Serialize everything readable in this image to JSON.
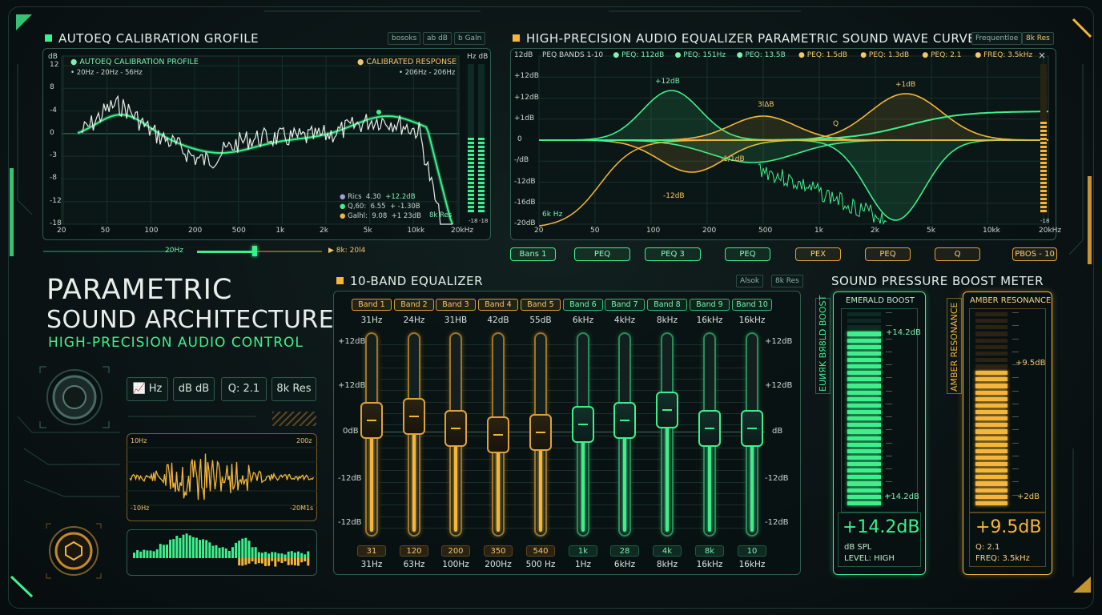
{
  "colors": {
    "emerald": "#3ef08c",
    "amber": "#f5b63a",
    "panel_border": "#2f5c4c",
    "bg": "#0b1416"
  },
  "autoeq": {
    "title": "AUTOEQ CALIBRATION GROFILE",
    "chips": [
      "bosoks",
      "ab dB",
      "b Galn"
    ],
    "legend_left_title": "AUTOEQ CALIBRATION PROFILE",
    "legend_left_sub": "20Hz  - 20Hz  - 56Hz",
    "legend_right_title": "CALIBRATED RESPONSE",
    "legend_right_sub": "206Hz  - 206Hz",
    "unit_top_left": "dB",
    "unit_top_right": "Hz  dB",
    "y_ticks": [
      "12",
      "8",
      "-4",
      "0",
      "-3",
      "-8",
      "-12",
      "-18"
    ],
    "x_ticks": [
      "20",
      "50",
      "100",
      "200",
      "500",
      "1k",
      "2k",
      "5k",
      "10kk",
      "20kHz"
    ],
    "stats": [
      {
        "label": "Rics",
        "v1": "4.30",
        "v2": "+12.2dB"
      },
      {
        "label": "Q,60:",
        "v1": "6.55",
        "v2": "+ -1.30B"
      },
      {
        "label": "Galhl:",
        "v1": "9.08",
        "v2": "+1 23dB"
      }
    ],
    "res_label": "8k Res",
    "meter_ticks": [
      "-18",
      "-18"
    ],
    "slider_left": "20Hz",
    "slider_right": "8k: 20l4",
    "slider_value": 0.46
  },
  "peq": {
    "title": "HIGH-PRECISION AUDIO EQUALIZER PARAMETRIC SOUND WAVE CURVES",
    "chips": [
      "Frequentloe",
      "8k Res"
    ],
    "y_ticks": [
      "12dB",
      "+12dB",
      "+12dB",
      "+1dB",
      "0",
      "-/dB",
      "-12dB",
      "-16dB",
      "-20dB"
    ],
    "x_ticks": [
      "20",
      "50",
      "100",
      "200",
      "500",
      "1k",
      "2k",
      "5k",
      "10kk",
      "20kHz"
    ],
    "legend": [
      {
        "text": "PEQ BANDS 1-10",
        "c": "plain"
      },
      {
        "text": "PEQ: 112dB",
        "c": "g"
      },
      {
        "text": "PEQ: 151Hz",
        "c": "g"
      },
      {
        "text": "PEQ: 13.5B",
        "c": "g"
      },
      {
        "text": "PEQ: 1.5dB",
        "c": "a"
      },
      {
        "text": "PEQ: 1.3dB",
        "c": "a"
      },
      {
        "text": "PEQ: 2.1",
        "c": "a"
      },
      {
        "text": "FREQ: 3.5kHz",
        "c": "a"
      }
    ],
    "annotations": [
      "+12dB",
      "+1dB",
      "3lΔB",
      "Q",
      "-1/1dB",
      "-12dB",
      "6k Hz"
    ],
    "pills": [
      {
        "label": "Bans 1",
        "c": "g"
      },
      {
        "label": "PEQ",
        "c": "g"
      },
      {
        "label": "PEQ 3",
        "c": "g"
      },
      {
        "label": "PEQ",
        "c": "g"
      },
      {
        "label": "PEX",
        "c": "a"
      },
      {
        "label": "PEQ",
        "c": "a"
      },
      {
        "label": "Q",
        "c": "a"
      },
      {
        "label": "PBOS - 10",
        "c": "a"
      }
    ],
    "meter_ticks": [
      "-18",
      "-18"
    ]
  },
  "hero": {
    "line1": "PARAMETRIC",
    "line2": "SOUND ARCHITECTURE",
    "line3": "HIGH-PRECISION AUDIO CONTROL",
    "buttons": [
      "Hz",
      "dB dB",
      "Q: 2.1",
      "8k Res"
    ],
    "wave_labels": [
      "10Hz",
      "200z",
      "-10Hz",
      "-20M1s"
    ]
  },
  "eq10": {
    "title": "10-BAND EQUALIZER",
    "chips": [
      "Alsok",
      "8k Res"
    ],
    "scale_left": [
      "+12dB",
      "+12dB",
      "0dB",
      "-12dB",
      "-12dB"
    ],
    "scale_right": [
      "+12dB",
      "+12dB",
      "dB",
      "-12dB",
      "-12dB"
    ],
    "bands": [
      {
        "name": "Band 1",
        "top": "31Hz",
        "value": "31",
        "bottom": "31Hz",
        "level": 0.57,
        "c": "a"
      },
      {
        "name": "Band 2",
        "top": "24Hz",
        "value": "120",
        "bottom": "63Hz",
        "level": 0.59,
        "c": "a"
      },
      {
        "name": "Band 3",
        "top": "31HB",
        "value": "200",
        "bottom": "100Hz",
        "level": 0.53,
        "c": "a"
      },
      {
        "name": "Band 4",
        "top": "42dB",
        "value": "350",
        "bottom": "200Hz",
        "level": 0.5,
        "c": "a"
      },
      {
        "name": "Band 5",
        "top": "55dB",
        "value": "540",
        "bottom": "500 Hz",
        "level": 0.51,
        "c": "a"
      },
      {
        "name": "Band 6",
        "top": "6kHz",
        "value": "1k",
        "bottom": "1Hz",
        "level": 0.55,
        "c": "g"
      },
      {
        "name": "Band 7",
        "top": "4kHz",
        "value": "28",
        "bottom": "6kHz",
        "level": 0.57,
        "c": "g"
      },
      {
        "name": "Band 8",
        "top": "8kHz",
        "value": "4k",
        "bottom": "8kHz",
        "level": 0.62,
        "c": "g"
      },
      {
        "name": "Band 9",
        "top": "16kHz",
        "value": "8k",
        "bottom": "16kHz",
        "level": 0.53,
        "c": "g"
      },
      {
        "name": "Band 10",
        "top": "16kHz",
        "value": "10",
        "bottom": "16kHz",
        "level": 0.53,
        "c": "g"
      }
    ]
  },
  "spl": {
    "title": "SOUND PRESSURE BOOST METER",
    "emerald": {
      "header": "EMERALD BOOST",
      "side": "EUИЯK BЯ8LD BOOST",
      "mark_top": "+14.2dB",
      "mark_bottom": "+14.2dB",
      "value": "+14.2dB",
      "line1": "dB SPL",
      "line2": "LEVEL: HIGH",
      "level": 0.88
    },
    "amber": {
      "header": "AMBER RESONANCE",
      "side": "AMBER RESONANCE",
      "mark_top": "+9.5dB",
      "mark_bottom": "+2dB",
      "value": "+9.5dB",
      "line1": "Q: 2.1",
      "line2": "FREQ: 3.5kHz",
      "level": 0.68
    }
  }
}
